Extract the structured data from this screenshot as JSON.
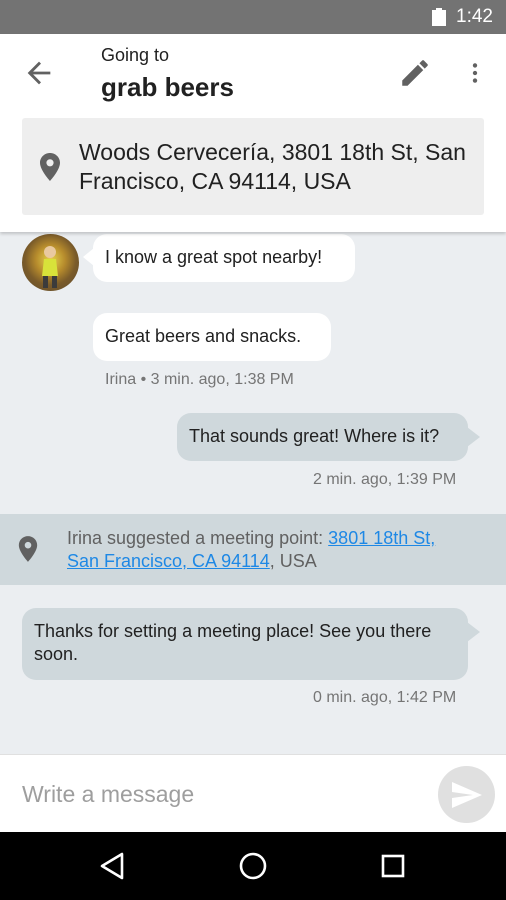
{
  "status_bar": {
    "time": "1:42"
  },
  "header": {
    "subtitle": "Going to",
    "title": "grab beers",
    "location_address": "Woods Cervecería, 3801 18th St, San Francisco, CA 94114, USA"
  },
  "messages": [
    {
      "text": "I know a great spot nearby!"
    },
    {
      "text": "Great beers and snacks.",
      "meta": "Irina • 3 min. ago, 1:38 PM"
    },
    {
      "text": "That sounds great! Where is it?",
      "meta": "2 min. ago, 1:39 PM"
    },
    {
      "text": "Thanks for setting a meeting place! See you there soon.",
      "meta": "0 min. ago, 1:42 PM"
    }
  ],
  "system_message": {
    "prefix": "Irina suggested a meeting point: ",
    "link_line1": "3801 18th St,",
    "link_line2": "San Francisco, CA 94114",
    "suffix": ", USA"
  },
  "composer": {
    "placeholder": "Write a message"
  },
  "icons": {
    "status": [
      "battery-icon"
    ],
    "header": [
      "back-arrow-icon",
      "edit-pencil-icon",
      "more-vert-icon",
      "location-pin-icon"
    ],
    "composer": [
      "send-icon"
    ],
    "nav": [
      "back-triangle-icon",
      "home-circle-icon",
      "recents-square-icon"
    ]
  },
  "colors": {
    "status_bar": "#737373",
    "background": "#ebeef1",
    "outgoing_bubble": "#cfd8dc",
    "incoming_bubble": "#ffffff",
    "link": "#1e88e5"
  }
}
